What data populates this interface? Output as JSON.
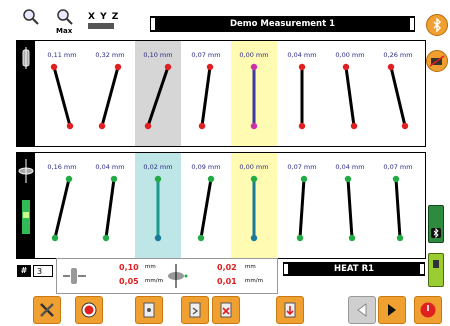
{
  "toolbar": {
    "max_label": "Max",
    "xyz_label": "X Y Z"
  },
  "title": "Demo Measurement 1",
  "panel_top": {
    "values": [
      "0,11 mm",
      "0,32 mm",
      "0,10 mm",
      "0,07 mm",
      "0,00 mm",
      "0,04 mm",
      "0,00 mm",
      "0,26 mm"
    ],
    "highlight": [
      "none",
      "none",
      "grey",
      "none",
      "yellow",
      "none",
      "none",
      "none"
    ],
    "tilt": [
      8,
      -8,
      -10,
      -4,
      0,
      0,
      4,
      7
    ],
    "rod_color": [
      "#000000",
      "#000000",
      "#000000",
      "#000000",
      "#3a3aa0",
      "#000000",
      "#000000",
      "#000000"
    ]
  },
  "panel_bottom": {
    "values": [
      "0,16 mm",
      "0,04 mm",
      "0,02 mm",
      "0,09 mm",
      "0,00 mm",
      "0,07 mm",
      "0,04 mm",
      "0,07 mm"
    ],
    "highlight": [
      "none",
      "none",
      "cyan",
      "none",
      "yellow",
      "none",
      "none",
      "none"
    ],
    "tilt": [
      -7,
      -4,
      0,
      -5,
      0,
      -2,
      2,
      2
    ],
    "rod_color": [
      "#000000",
      "#000000",
      "#1a9a8a",
      "#000000",
      "#1a7a9a",
      "#000000",
      "#000000",
      "#000000"
    ]
  },
  "readout": {
    "hash": "#",
    "counter": "3",
    "val1": "0,10",
    "unit1": "mm",
    "val2": "0,05",
    "unit2": "mm/m",
    "val3": "0,02",
    "unit3": "mm",
    "val4": "0,01",
    "unit4": "mm/m",
    "machine": "HEAT R1"
  },
  "colors": {
    "accent_orange": "#f0a030",
    "alert_red": "#e02020",
    "dot_red": "#e02020",
    "dot_green": "#22aa44",
    "dot_magenta": "#cc33aa"
  }
}
